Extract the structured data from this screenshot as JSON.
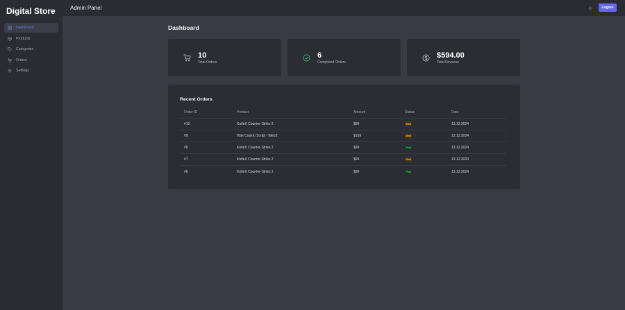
{
  "brand": "Digital Store",
  "header": {
    "title": "Admin Panel",
    "logout_label": "Logout",
    "settings_icon": "gear-icon"
  },
  "sidebar": {
    "items": [
      {
        "label": "Dashboard",
        "icon": "grid-icon",
        "active": true
      },
      {
        "label": "Products",
        "icon": "box-icon",
        "active": false
      },
      {
        "label": "Categories",
        "icon": "tag-icon",
        "active": false
      },
      {
        "label": "Orders",
        "icon": "cart-icon",
        "active": false
      },
      {
        "label": "Settings",
        "icon": "gear-icon",
        "active": false
      }
    ]
  },
  "page": {
    "title": "Dashboard"
  },
  "stats": [
    {
      "value": "10",
      "label": "Total Orders",
      "icon": "cart-icon"
    },
    {
      "value": "6",
      "label": "Completed Orders",
      "icon": "check-circle-icon"
    },
    {
      "value": "$594.00",
      "label": "Total Revenue",
      "icon": "dollar-circle-icon"
    }
  ],
  "recent_orders": {
    "title": "Recent Orders",
    "columns": [
      "Order ID",
      "Product",
      "Amount",
      "Status",
      "Date"
    ],
    "rows": [
      {
        "id": "#10",
        "product": "KnifeX Counter-Strike 2",
        "amount": "$99",
        "status": "Wait",
        "date": "13.12.2024"
      },
      {
        "id": "#9",
        "product": "Wax Casino Script - Web3",
        "amount": "$199",
        "status": "Wait",
        "date": "13.12.2024"
      },
      {
        "id": "#8",
        "product": "KnifeX Counter-Strike 2",
        "amount": "$99",
        "status": "Paid",
        "date": "13.12.2024"
      },
      {
        "id": "#7",
        "product": "KnifeX Counter-Strike 2",
        "amount": "$99",
        "status": "Wait",
        "date": "13.12.2024"
      },
      {
        "id": "#6",
        "product": "KnifeX Counter-Strike 2",
        "amount": "$99",
        "status": "Paid",
        "date": "13.12.2024"
      }
    ]
  },
  "colors": {
    "accent": "#6366f1",
    "wait": "#f2b823",
    "paid": "#2fcf73",
    "panel": "#2c2d33",
    "background": "#393a43"
  }
}
